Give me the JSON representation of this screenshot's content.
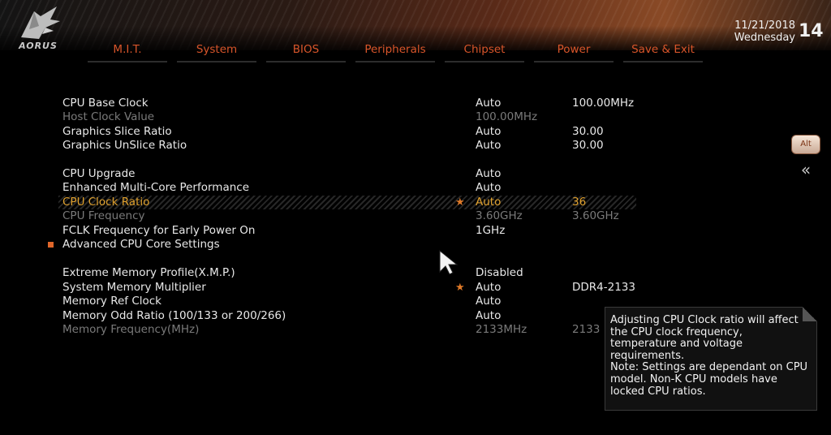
{
  "brand": {
    "logo_text": "AORUS"
  },
  "header": {
    "date": "11/21/2018",
    "weekday": "Wednesday",
    "time_partial": "14"
  },
  "tabs": [
    {
      "label": "M.I.T.",
      "active": true
    },
    {
      "label": "System"
    },
    {
      "label": "BIOS"
    },
    {
      "label": "Peripherals"
    },
    {
      "label": "Chipset"
    },
    {
      "label": "Power"
    },
    {
      "label": "Save & Exit"
    }
  ],
  "settings": [
    {
      "label": "CPU Base Clock",
      "value": "Auto",
      "value2": "100.00MHz"
    },
    {
      "label": "Host Clock Value",
      "value": "100.00MHz",
      "value2": "",
      "dim": true
    },
    {
      "label": "Graphics Slice Ratio",
      "value": "Auto",
      "value2": "30.00"
    },
    {
      "label": "Graphics UnSlice Ratio",
      "value": "Auto",
      "value2": "30.00"
    },
    {
      "label": "CPU Upgrade",
      "value": "Auto",
      "value2": ""
    },
    {
      "label": "Enhanced Multi-Core Performance",
      "value": "Auto",
      "value2": ""
    },
    {
      "label": "CPU Clock Ratio",
      "value": "Auto",
      "value2": "36",
      "starred": true,
      "selected": true
    },
    {
      "label": "CPU Frequency",
      "value": "3.60GHz",
      "value2": "3.60GHz",
      "dim": true
    },
    {
      "label": "FCLK Frequency for Early Power On",
      "value": "1GHz",
      "value2": ""
    },
    {
      "label": "Advanced CPU Core Settings",
      "value": "",
      "value2": "",
      "submenu": true
    },
    {
      "label": "Extreme Memory Profile(X.M.P.)",
      "value": "Disabled",
      "value2": ""
    },
    {
      "label": "System Memory Multiplier",
      "value": "Auto",
      "value2": "DDR4-2133",
      "starred": true
    },
    {
      "label": "Memory Ref Clock",
      "value": "Auto",
      "value2": ""
    },
    {
      "label": "Memory Odd Ratio (100/133 or 200/266)",
      "value": "Auto",
      "value2": ""
    },
    {
      "label": "Memory Frequency(MHz)",
      "value": "2133MHz",
      "value2": "2133",
      "dim": true
    }
  ],
  "side_buttons": {
    "alt_label": "Alt",
    "back_glyph": "«"
  },
  "help": {
    "text": "Adjusting CPU Clock ratio will affect the CPU clock frequency, temperature and voltage requirements.\nNote: Settings are dependant  on  CPU model. Non-K CPU models have locked CPU ratios."
  },
  "colors": {
    "accent_orange": "#d8552a",
    "active_tab": "#f3c27a",
    "selected_row": "#e0a12e",
    "dim_text": "#7a7a7a"
  }
}
